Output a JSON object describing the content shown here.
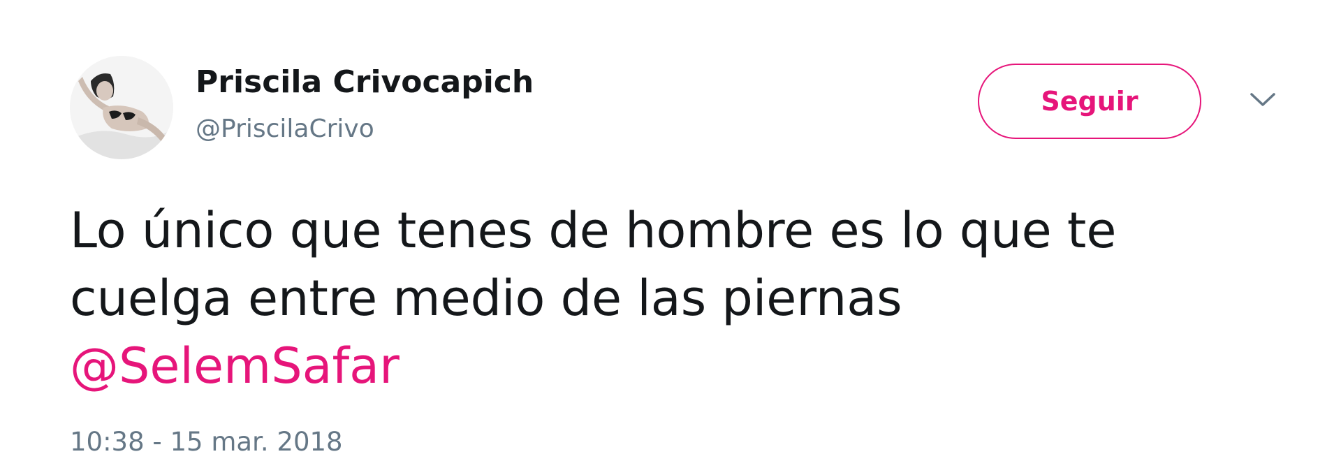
{
  "colors": {
    "accent": "#e6157a",
    "text": "#14171a",
    "secondary_text": "#657786"
  },
  "author": {
    "display_name": "Priscila Crivocapich",
    "handle": "@PriscilaCrivo",
    "avatar_icon": "profile-photo"
  },
  "actions": {
    "follow_label": "Seguir",
    "more_icon": "chevron-down-icon"
  },
  "tweet": {
    "text_line_1": "Lo único que tenes de hombre es lo que te",
    "text_line_2": "cuelga entre medio de las piernas",
    "mention": "@SelemSafar",
    "timestamp": "10:38 - 15 mar. 2018"
  }
}
